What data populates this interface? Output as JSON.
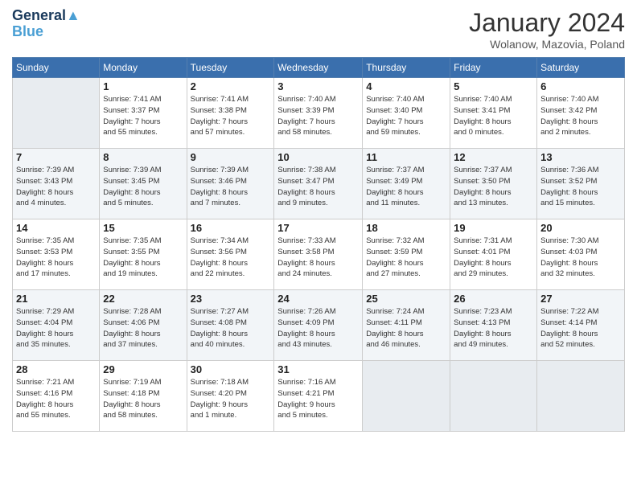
{
  "header": {
    "logo_line1": "General",
    "logo_line2": "Blue",
    "month": "January 2024",
    "location": "Wolanow, Mazovia, Poland"
  },
  "days_of_week": [
    "Sunday",
    "Monday",
    "Tuesday",
    "Wednesday",
    "Thursday",
    "Friday",
    "Saturday"
  ],
  "weeks": [
    [
      {
        "num": "",
        "info": ""
      },
      {
        "num": "1",
        "info": "Sunrise: 7:41 AM\nSunset: 3:37 PM\nDaylight: 7 hours\nand 55 minutes."
      },
      {
        "num": "2",
        "info": "Sunrise: 7:41 AM\nSunset: 3:38 PM\nDaylight: 7 hours\nand 57 minutes."
      },
      {
        "num": "3",
        "info": "Sunrise: 7:40 AM\nSunset: 3:39 PM\nDaylight: 7 hours\nand 58 minutes."
      },
      {
        "num": "4",
        "info": "Sunrise: 7:40 AM\nSunset: 3:40 PM\nDaylight: 7 hours\nand 59 minutes."
      },
      {
        "num": "5",
        "info": "Sunrise: 7:40 AM\nSunset: 3:41 PM\nDaylight: 8 hours\nand 0 minutes."
      },
      {
        "num": "6",
        "info": "Sunrise: 7:40 AM\nSunset: 3:42 PM\nDaylight: 8 hours\nand 2 minutes."
      }
    ],
    [
      {
        "num": "7",
        "info": "Sunrise: 7:39 AM\nSunset: 3:43 PM\nDaylight: 8 hours\nand 4 minutes."
      },
      {
        "num": "8",
        "info": "Sunrise: 7:39 AM\nSunset: 3:45 PM\nDaylight: 8 hours\nand 5 minutes."
      },
      {
        "num": "9",
        "info": "Sunrise: 7:39 AM\nSunset: 3:46 PM\nDaylight: 8 hours\nand 7 minutes."
      },
      {
        "num": "10",
        "info": "Sunrise: 7:38 AM\nSunset: 3:47 PM\nDaylight: 8 hours\nand 9 minutes."
      },
      {
        "num": "11",
        "info": "Sunrise: 7:37 AM\nSunset: 3:49 PM\nDaylight: 8 hours\nand 11 minutes."
      },
      {
        "num": "12",
        "info": "Sunrise: 7:37 AM\nSunset: 3:50 PM\nDaylight: 8 hours\nand 13 minutes."
      },
      {
        "num": "13",
        "info": "Sunrise: 7:36 AM\nSunset: 3:52 PM\nDaylight: 8 hours\nand 15 minutes."
      }
    ],
    [
      {
        "num": "14",
        "info": "Sunrise: 7:35 AM\nSunset: 3:53 PM\nDaylight: 8 hours\nand 17 minutes."
      },
      {
        "num": "15",
        "info": "Sunrise: 7:35 AM\nSunset: 3:55 PM\nDaylight: 8 hours\nand 19 minutes."
      },
      {
        "num": "16",
        "info": "Sunrise: 7:34 AM\nSunset: 3:56 PM\nDaylight: 8 hours\nand 22 minutes."
      },
      {
        "num": "17",
        "info": "Sunrise: 7:33 AM\nSunset: 3:58 PM\nDaylight: 8 hours\nand 24 minutes."
      },
      {
        "num": "18",
        "info": "Sunrise: 7:32 AM\nSunset: 3:59 PM\nDaylight: 8 hours\nand 27 minutes."
      },
      {
        "num": "19",
        "info": "Sunrise: 7:31 AM\nSunset: 4:01 PM\nDaylight: 8 hours\nand 29 minutes."
      },
      {
        "num": "20",
        "info": "Sunrise: 7:30 AM\nSunset: 4:03 PM\nDaylight: 8 hours\nand 32 minutes."
      }
    ],
    [
      {
        "num": "21",
        "info": "Sunrise: 7:29 AM\nSunset: 4:04 PM\nDaylight: 8 hours\nand 35 minutes."
      },
      {
        "num": "22",
        "info": "Sunrise: 7:28 AM\nSunset: 4:06 PM\nDaylight: 8 hours\nand 37 minutes."
      },
      {
        "num": "23",
        "info": "Sunrise: 7:27 AM\nSunset: 4:08 PM\nDaylight: 8 hours\nand 40 minutes."
      },
      {
        "num": "24",
        "info": "Sunrise: 7:26 AM\nSunset: 4:09 PM\nDaylight: 8 hours\nand 43 minutes."
      },
      {
        "num": "25",
        "info": "Sunrise: 7:24 AM\nSunset: 4:11 PM\nDaylight: 8 hours\nand 46 minutes."
      },
      {
        "num": "26",
        "info": "Sunrise: 7:23 AM\nSunset: 4:13 PM\nDaylight: 8 hours\nand 49 minutes."
      },
      {
        "num": "27",
        "info": "Sunrise: 7:22 AM\nSunset: 4:14 PM\nDaylight: 8 hours\nand 52 minutes."
      }
    ],
    [
      {
        "num": "28",
        "info": "Sunrise: 7:21 AM\nSunset: 4:16 PM\nDaylight: 8 hours\nand 55 minutes."
      },
      {
        "num": "29",
        "info": "Sunrise: 7:19 AM\nSunset: 4:18 PM\nDaylight: 8 hours\nand 58 minutes."
      },
      {
        "num": "30",
        "info": "Sunrise: 7:18 AM\nSunset: 4:20 PM\nDaylight: 9 hours\nand 1 minute."
      },
      {
        "num": "31",
        "info": "Sunrise: 7:16 AM\nSunset: 4:21 PM\nDaylight: 9 hours\nand 5 minutes."
      },
      {
        "num": "",
        "info": ""
      },
      {
        "num": "",
        "info": ""
      },
      {
        "num": "",
        "info": ""
      }
    ]
  ]
}
